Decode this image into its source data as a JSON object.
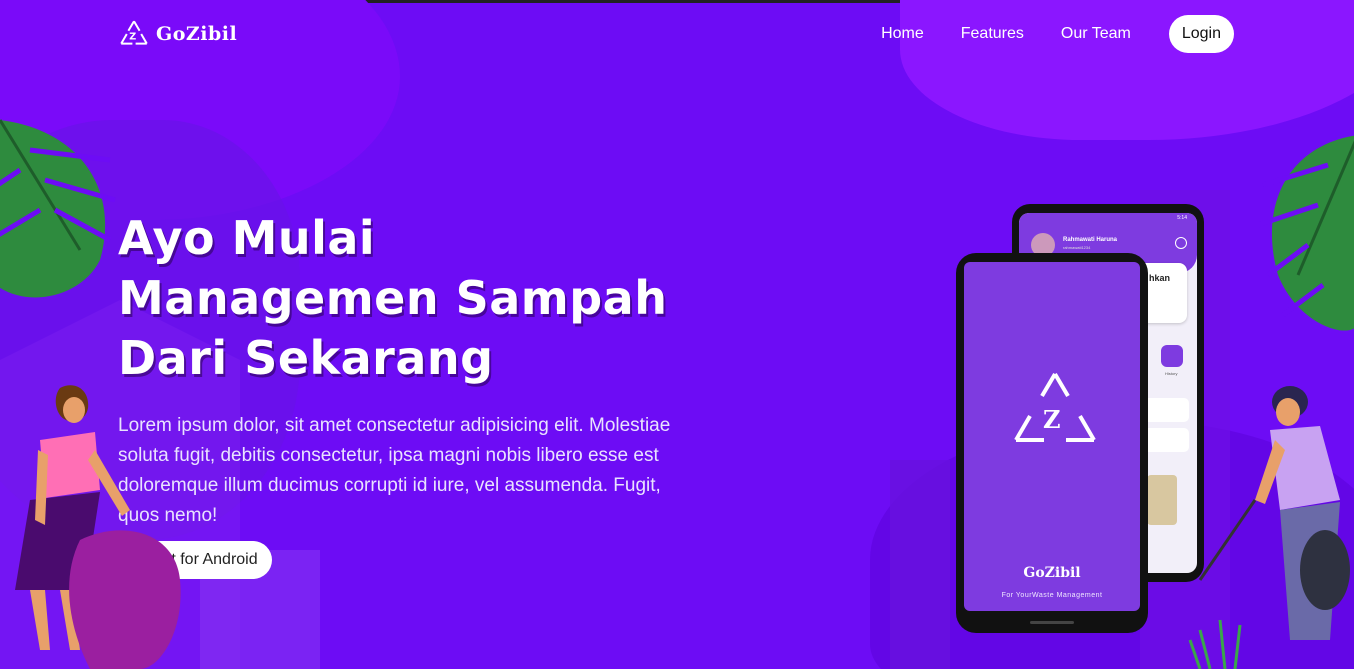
{
  "brand": {
    "name": "GoZibil"
  },
  "nav": {
    "items": [
      "Home",
      "Features",
      "Our Team"
    ],
    "login": "Login"
  },
  "hero": {
    "title_lines": [
      "Ayo Mulai",
      "Managemen Sampah",
      "Dari Sekarang"
    ],
    "description": "Lorem ipsum dolor, sit amet consectetur adipisicing elit. Molestiae soluta fugit, debitis consectetur, ipsa magni nobis libero esse est doloremque illum ducimus corrupti id iure, vel assumenda. Fugit, quos nemo!",
    "cta": "Get for Android"
  },
  "phone": {
    "app_name": "GoZibil",
    "app_tagline": "For YourWaste Management",
    "profile_name": "Rahmawati Haruna",
    "profile_handle": "rahmawati1234",
    "card_title": "hkan",
    "status_time": "5:14",
    "history_label": "History"
  },
  "colors": {
    "background": "#6d0cf5",
    "accent": "#7e3be0"
  }
}
